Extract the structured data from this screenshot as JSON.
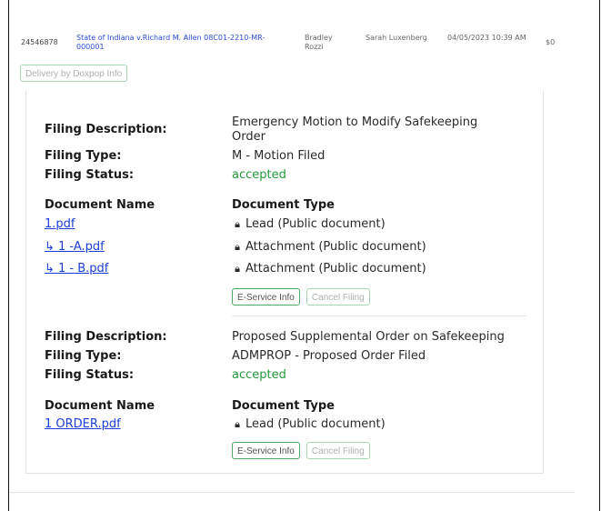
{
  "row": {
    "id": "24546878",
    "case": "State of Indiana v.Richard M. Allen 08C01-2210-MR-000001",
    "judge": "Bradley Rozzi",
    "clerk": "Sarah Luxenberg",
    "date": "04/05/2023 10:39 AM",
    "fee": "$0"
  },
  "delivery_button": "Delivery by Doxpop Info",
  "labels": {
    "filing_description": "Filing Description:",
    "filing_type": "Filing Type:",
    "filing_status": "Filing Status:",
    "document_name": "Document Name",
    "document_type": "Document Type"
  },
  "icons": {
    "lock": "lock-icon"
  },
  "filings": [
    {
      "description": "Emergency Motion to Modify Safekeeping Order",
      "type": "M - Motion Filed",
      "status": "accepted",
      "documents": [
        {
          "name": "1.pdf",
          "type": "Lead (Public document)"
        },
        {
          "name": "↳ 1 -A.pdf",
          "type": "Attachment (Public document)"
        },
        {
          "name": "↳ 1 - B.pdf",
          "type": "Attachment (Public document)"
        }
      ],
      "eservice_button": "E-Service Info",
      "cancel_button": "Cancel Filing"
    },
    {
      "description": "Proposed Supplemental Order on Safekeeping",
      "type": "ADMPROP - Proposed Order Filed",
      "status": "accepted",
      "documents": [
        {
          "name": "1 ORDER.pdf",
          "type": "Lead (Public document)"
        }
      ],
      "eservice_button": "E-Service Info",
      "cancel_button": "Cancel Filing"
    }
  ],
  "colors": {
    "link": "#1c3ddb",
    "status_accepted": "#239a3b",
    "button_border": "#4caa66"
  }
}
